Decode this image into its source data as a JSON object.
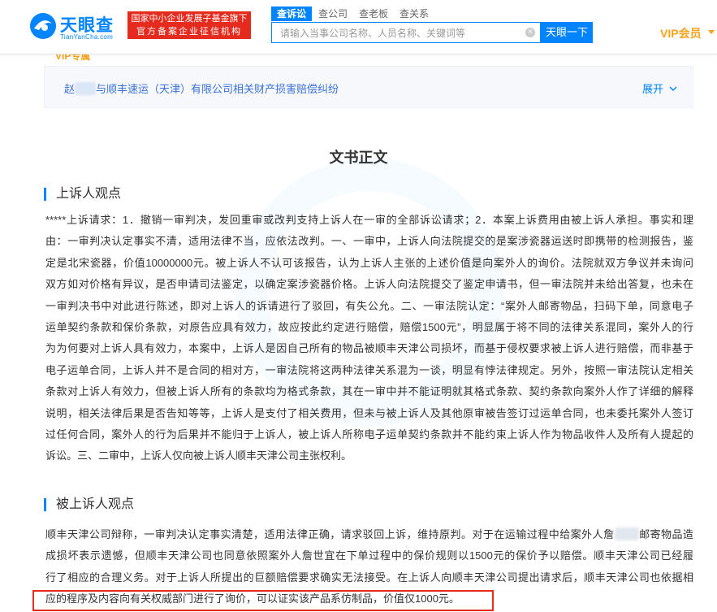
{
  "header": {
    "logo_text": "天眼查",
    "logo_sub": "TianYanCha.com",
    "gov_badge_line1": "国家中小企业发展子基金旗下",
    "gov_badge_line2": "官方备案企业征信机构",
    "tabs": [
      {
        "label": "查诉讼",
        "active": true
      },
      {
        "label": "查公司",
        "active": false
      },
      {
        "label": "查老板",
        "active": false
      },
      {
        "label": "查关系",
        "active": false
      }
    ],
    "search_placeholder": "请输入当事公司名称、人员名称、关键词等",
    "search_button": "天眼一下",
    "vip_label": "VIP会员"
  },
  "related_case": {
    "prefix": "赵",
    "title_rest": "与顺丰速运（天津）有限公司相关财产损害赔偿纠纷",
    "expand_label": "展开"
  },
  "partial_row": {
    "vip_tag": "VIP专属"
  },
  "document": {
    "title": "文书正文",
    "sections": [
      {
        "heading": "上诉人观点",
        "lines": [
          "*****上诉请求：1．撤销一审判决，发回重审或改判支持上诉人在一审的全部诉讼请求；2．本案上诉费用由被上诉人承担。事实和理",
          "由：一审判决认定事实不清，适用法律不当，应依法改判。一、一审中，上诉人向法院提交的是案涉瓷器运送时即携带的检测报告，鉴",
          "定是北宋瓷器，价值10000000元。被上诉人不认可该报告，认为上诉人主张的上述价值是向案外人的询价。法院就双方争议并未询问",
          "双方如对价格有异议，是否申请司法鉴定，以确定案涉瓷器价格。上诉人向法院提交了鉴定申请书，但一审法院并未给出答复，也未在",
          "一审判决书中对此进行陈述，即对上诉人的诉请进行了驳回，有失公允。二、一审法院认定：“案外人邮寄物品，扫码下单，同意电子",
          "运单契约条款和保价条款，对原告应具有效力，故应按此约定进行赔偿，赔偿1500元”，明显属于将不同的法律关系混同，案外人的行",
          "为为何要对上诉人具有效力，本案中，上诉人是因自己所有的物品被顺丰天津公司损坏，而基于侵权要求被上诉人进行赔偿，而非基于",
          "电子运单合同，上诉人并不是合同的相对方，一审法院将这两种法律关系混为一谈，明显有悖法律规定。另外，按照一审法院认定相关",
          "条款对上诉人有效力，但被上诉人所有的条款均为格式条款，其在一审中并不能证明就其格式条款、契约条款向案外人作了详细的解释",
          "说明，相关法律后果是否告知等等，上诉人是支付了相关费用，但未与被上诉人及其他原审被告签订过运单合同，也未委托案外人签订",
          "过任何合同，案外人的行为后果并不能归于上诉人，被上诉人所称电子运单契约条款并不能约束上诉人作为物品收件人及所有人提起的",
          "诉讼。三、二审中，上诉人仅向被上诉人顺丰天津公司主张权利。"
        ]
      },
      {
        "heading": "被上诉人观点",
        "lines_before_blur": "顺丰天津公司辩称，一审判决认定事实清楚，适用法律正确，请求驳回上诉，维持原判。对于在运输过程中给案外人詹",
        "lines_after_blur": "邮寄物品造",
        "lines": [
          "成损坏表示遗憾，但顺丰天津公司也同意依照案外人詹世宜在下单过程中的保价规则以1500元的保价予以赔偿。顺丰天津公司已经履",
          "行了相应的合理义务。对于上诉人所提出的巨额赔偿要求确实无法接受。在上诉人向顺丰天津公司提出请求后，顺丰天津公司也依据相",
          "应的程序及内容向有关权威部门进行了询价，可以证实该产品系仿制品，价值仅1000元。"
        ]
      }
    ]
  },
  "colors": {
    "brand_blue": "#0084ff",
    "vip_orange": "#f7a21b",
    "badge_red": "#e52a1e",
    "highlight_red": "#e52a1e"
  }
}
